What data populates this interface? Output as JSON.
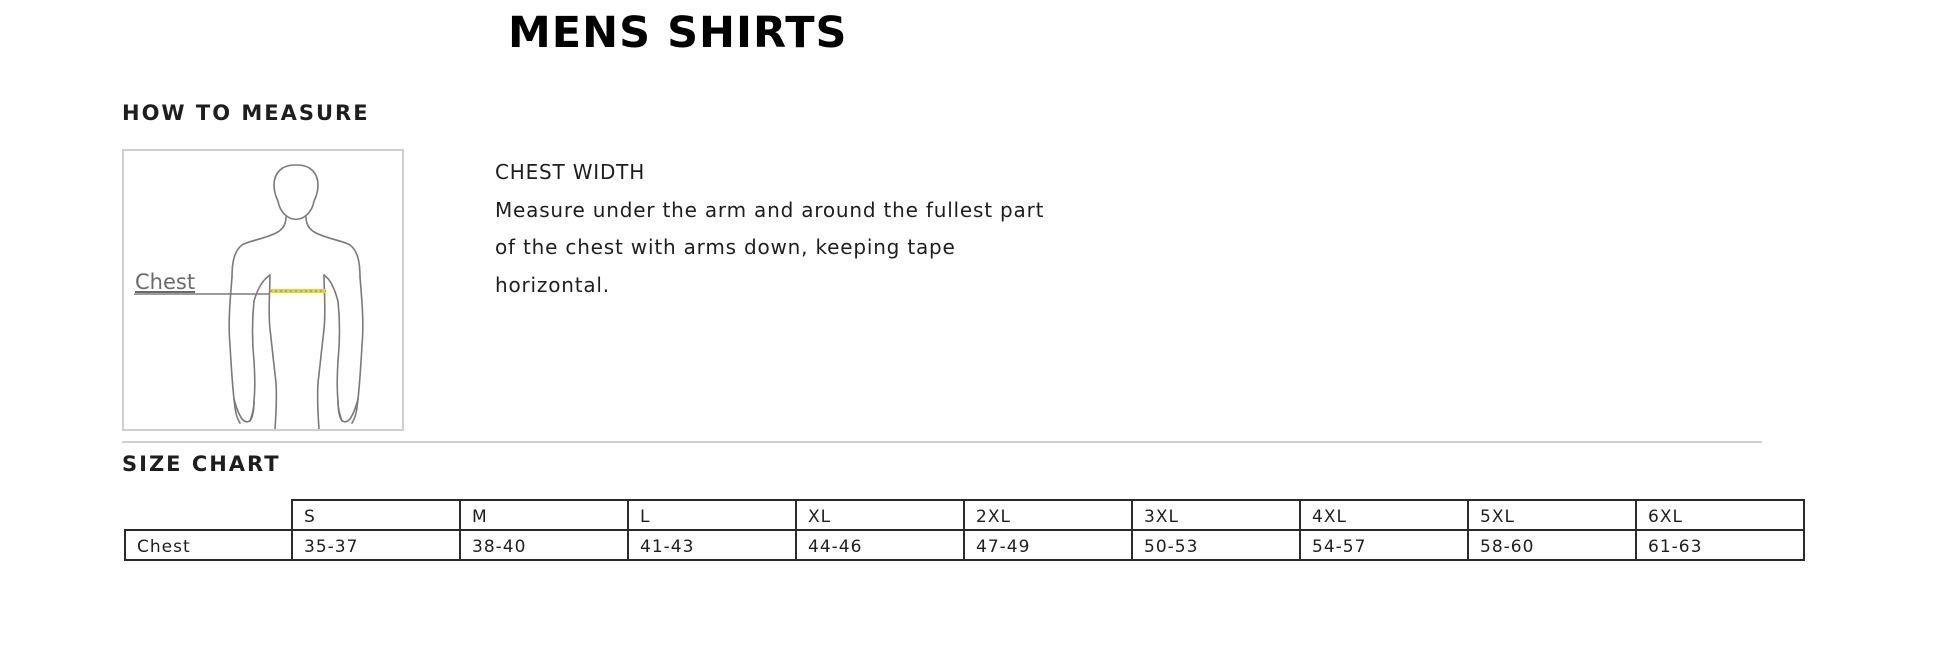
{
  "page": {
    "title": "MENS SHIRTS"
  },
  "how_to_measure": {
    "heading": "HOW TO MEASURE",
    "figure": {
      "label": "Chest",
      "tape_color": "#e8d23a",
      "outline_color": "#7a7a7a"
    },
    "measurement_name": "CHEST WIDTH",
    "instructions_line1": "Measure under the arm and around the fullest part",
    "instructions_line2": "of the chest with arms down, keeping tape",
    "instructions_line3": "horizontal."
  },
  "size_chart": {
    "heading": "SIZE CHART",
    "sizes": [
      "S",
      "M",
      "L",
      "XL",
      "2XL",
      "3XL",
      "4XL",
      "5XL",
      "6XL"
    ],
    "rows": [
      {
        "label": "Chest",
        "values": [
          "35-37",
          "38-40",
          "41-43",
          "44-46",
          "47-49",
          "50-53",
          "54-57",
          "58-60",
          "61-63"
        ]
      }
    ]
  }
}
